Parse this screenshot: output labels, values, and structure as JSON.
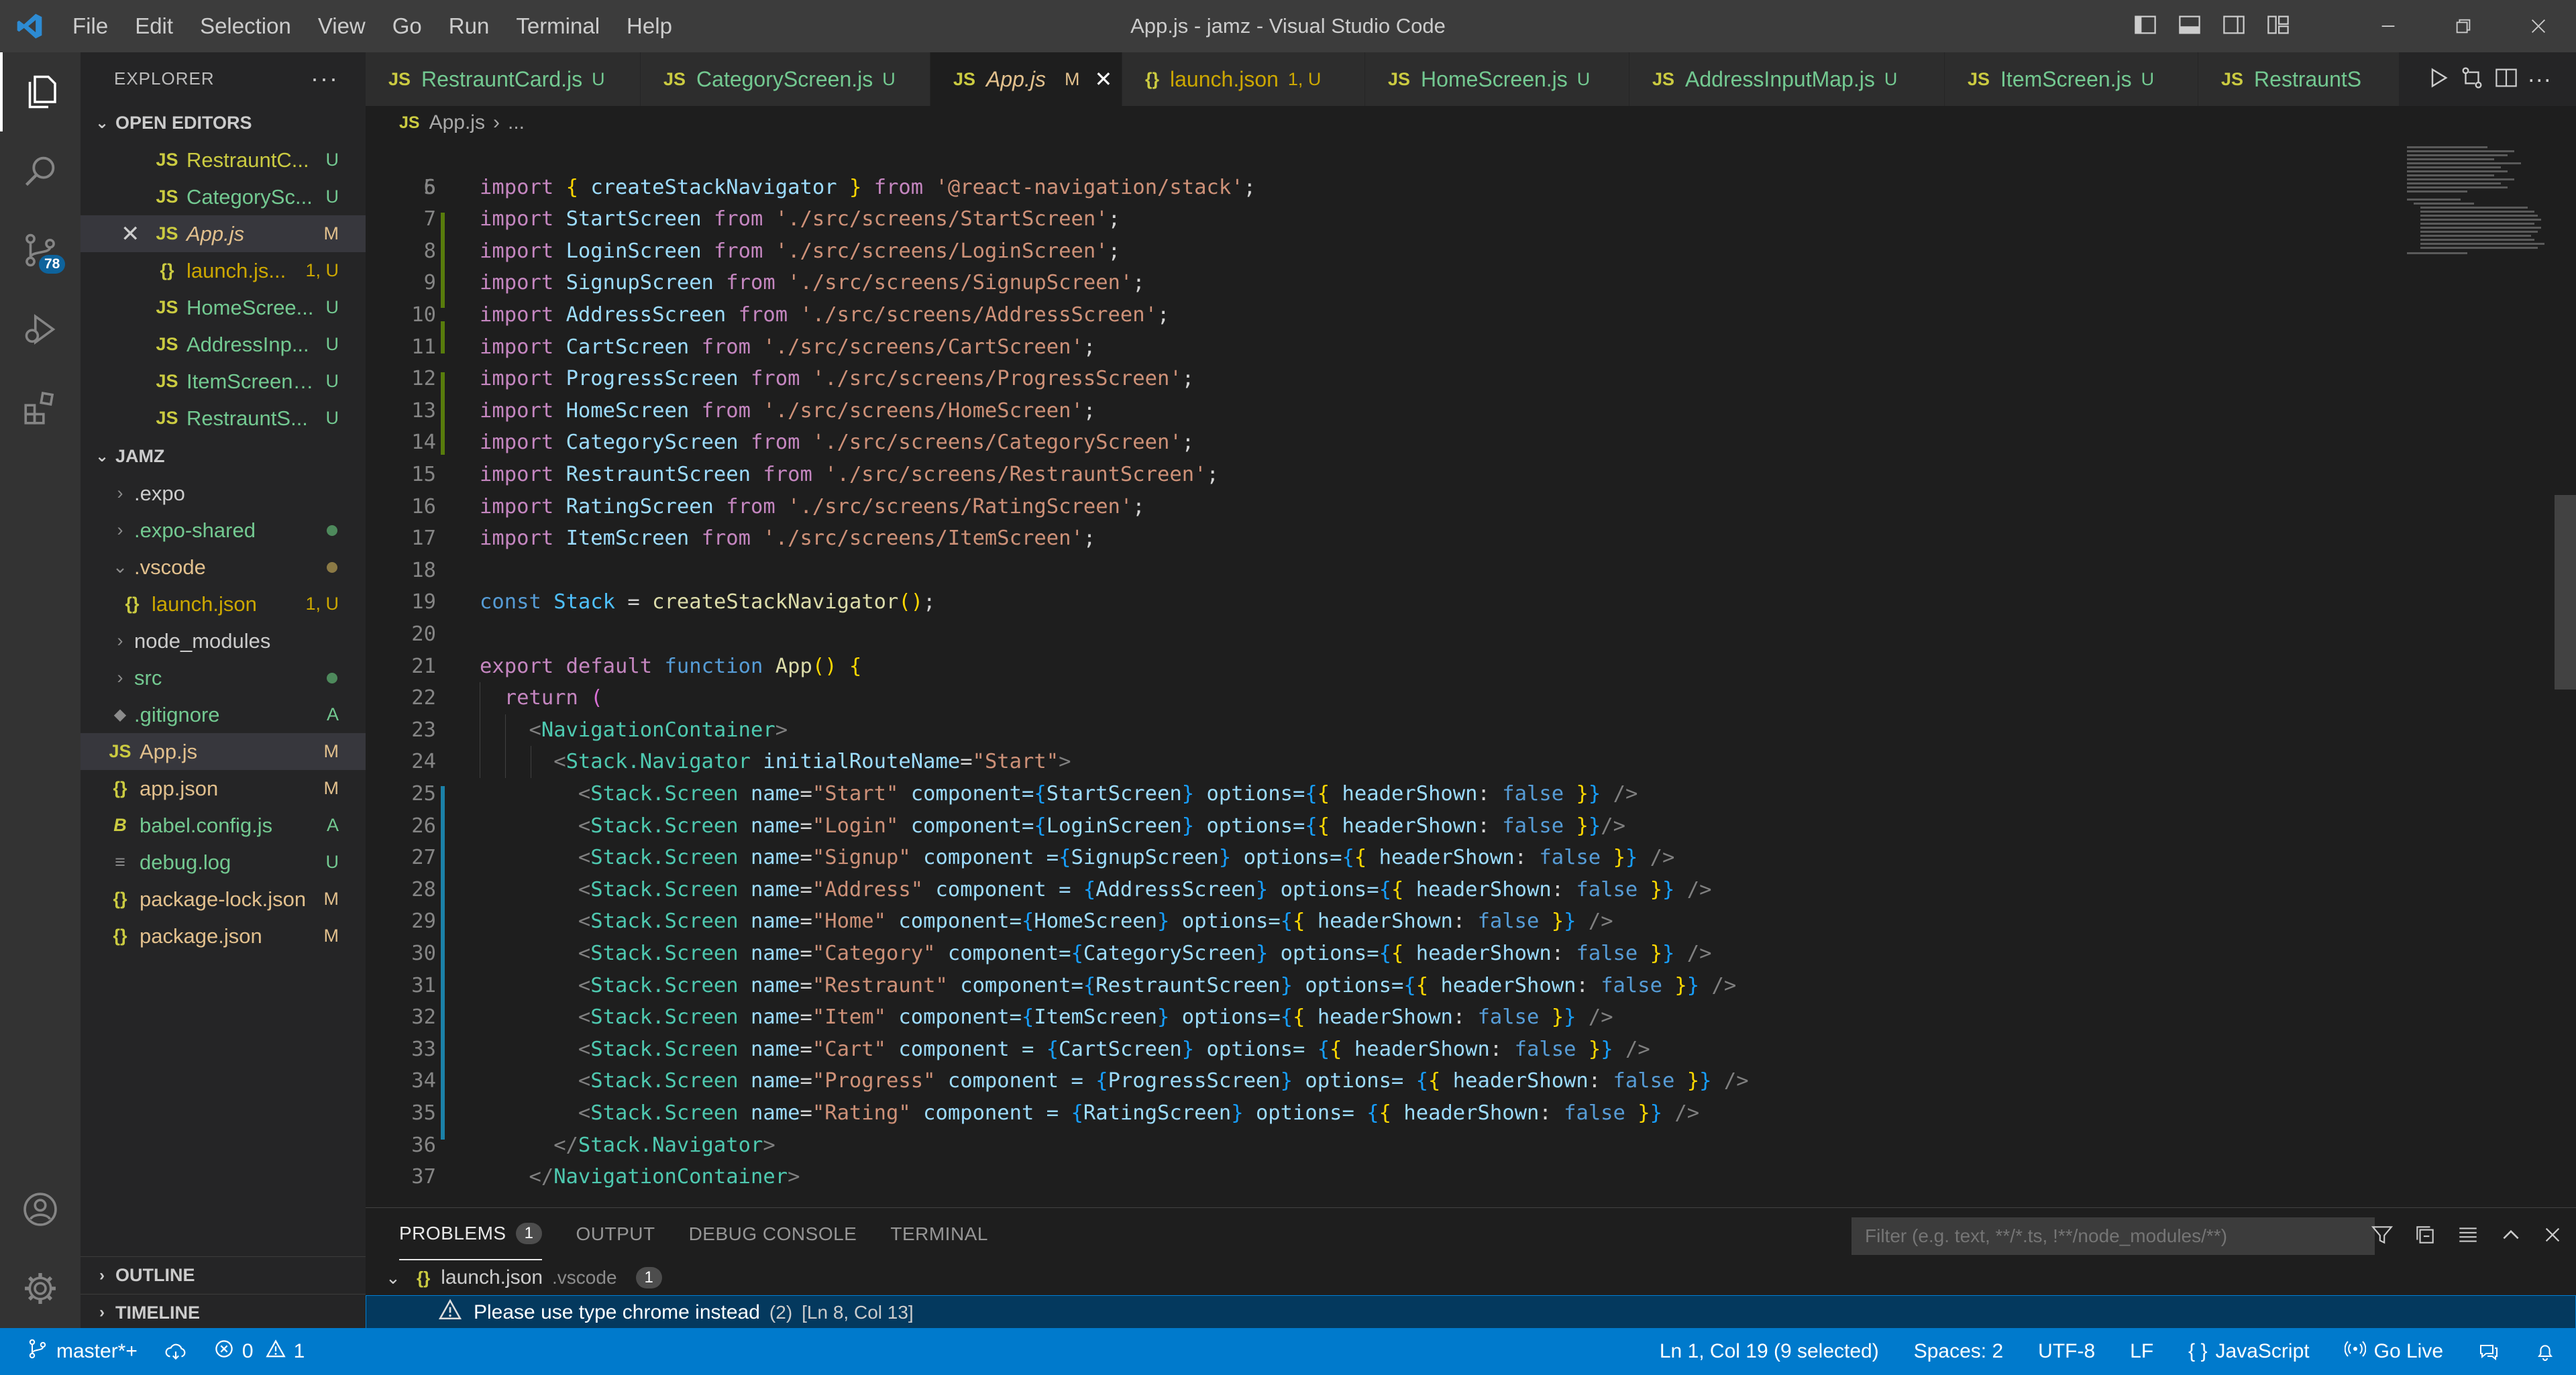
{
  "window": {
    "title": "App.js - jamz - Visual Studio Code"
  },
  "menu": [
    "File",
    "Edit",
    "Selection",
    "View",
    "Go",
    "Run",
    "Terminal",
    "Help"
  ],
  "activity": {
    "scm_badge": "78"
  },
  "explorer": {
    "title": "EXPLORER",
    "open_editors_label": "OPEN EDITORS",
    "open_editors": [
      {
        "icon": "JS",
        "name": "RestrauntC...",
        "status": "U"
      },
      {
        "icon": "JS",
        "name": "CategorySc...",
        "status": "U"
      },
      {
        "icon": "JS",
        "name": "App.js",
        "status": "M"
      },
      {
        "icon": "{}",
        "name": "launch.js...",
        "status": "1, U"
      },
      {
        "icon": "JS",
        "name": "HomeScree...",
        "status": "U"
      },
      {
        "icon": "JS",
        "name": "AddressInp...",
        "status": "U"
      },
      {
        "icon": "JS",
        "name": "ItemScreen....",
        "status": "U"
      },
      {
        "icon": "JS",
        "name": "RestrauntS...",
        "status": "U"
      }
    ],
    "project_label": "JAMZ",
    "tree": [
      {
        "name": ".expo",
        "status": ""
      },
      {
        "name": ".expo-shared",
        "status": ""
      },
      {
        "name": ".vscode",
        "status": ""
      },
      {
        "name": "launch.json",
        "status": "1, U",
        "icon": "{}"
      },
      {
        "name": "node_modules",
        "status": ""
      },
      {
        "name": "src",
        "status": ""
      },
      {
        "name": ".gitignore",
        "status": "A"
      },
      {
        "name": "App.js",
        "status": "M",
        "icon": "JS"
      },
      {
        "name": "app.json",
        "status": "M",
        "icon": "{}"
      },
      {
        "name": "babel.config.js",
        "status": "A",
        "icon": "B"
      },
      {
        "name": "debug.log",
        "status": "U",
        "icon": "≡"
      },
      {
        "name": "package-lock.json",
        "status": "M",
        "icon": "{}"
      },
      {
        "name": "package.json",
        "status": "M",
        "icon": "{}"
      }
    ],
    "outline_label": "OUTLINE",
    "timeline_label": "TIMELINE"
  },
  "tabs": [
    {
      "icon": "JS",
      "name": "RestrauntCard.js",
      "status": "U"
    },
    {
      "icon": "JS",
      "name": "CategoryScreen.js",
      "status": "U"
    },
    {
      "icon": "JS",
      "name": "App.js",
      "status": "M"
    },
    {
      "icon": "{}",
      "name": "launch.json",
      "status": "1, U"
    },
    {
      "icon": "JS",
      "name": "HomeScreen.js",
      "status": "U"
    },
    {
      "icon": "JS",
      "name": "AddressInputMap.js",
      "status": "U"
    },
    {
      "icon": "JS",
      "name": "ItemScreen.js",
      "status": "U"
    },
    {
      "icon": "JS",
      "name": "RestrauntS",
      "status": ""
    }
  ],
  "breadcrumb": {
    "file": "App.js",
    "rest": "..."
  },
  "code": {
    "imports": [
      {
        "n": "7",
        "name": "StartScreen",
        "path": "'./src/screens/StartScreen'"
      },
      {
        "n": "8",
        "name": "LoginScreen",
        "path": "'./src/screens/LoginScreen'"
      },
      {
        "n": "9",
        "name": "SignupScreen",
        "path": "'./src/screens/SignupScreen'"
      },
      {
        "n": "10",
        "name": "AddressScreen",
        "path": "'./src/screens/AddressScreen'"
      },
      {
        "n": "11",
        "name": "CartScreen",
        "path": "'./src/screens/CartScreen'"
      },
      {
        "n": "12",
        "name": "ProgressScreen",
        "path": "'./src/screens/ProgressScreen'"
      },
      {
        "n": "13",
        "name": "HomeScreen",
        "path": "'./src/screens/HomeScreen'"
      },
      {
        "n": "14",
        "name": "CategoryScreen",
        "path": "'./src/screens/CategoryScreen'"
      },
      {
        "n": "15",
        "name": "RestrauntScreen",
        "path": "'./src/screens/RestrauntScreen'"
      },
      {
        "n": "16",
        "name": "RatingScreen",
        "path": "'./src/screens/RatingScreen'"
      },
      {
        "n": "17",
        "name": "ItemScreen",
        "path": "'./src/screens/ItemScreen'"
      }
    ],
    "screens": [
      {
        "n": "25",
        "name": "\"Start\"",
        "comp_sep": " component=",
        "comp": "StartScreen",
        "opt_sep": " options=",
        "close": " />"
      },
      {
        "n": "26",
        "name": "\"Login\"",
        "comp_sep": " component=",
        "comp": "LoginScreen",
        "opt_sep": " options=",
        "close": "/>"
      },
      {
        "n": "27",
        "name": "\"Signup\"",
        "comp_sep": " component =",
        "comp": "SignupScreen",
        "opt_sep": " options=",
        "close": " />"
      },
      {
        "n": "28",
        "name": "\"Address\"",
        "comp_sep": " component = ",
        "comp": "AddressScreen",
        "opt_sep": " options=",
        "close": " />"
      },
      {
        "n": "29",
        "name": "\"Home\"",
        "comp_sep": " component=",
        "comp": "HomeScreen",
        "opt_sep": " options=",
        "close": " />"
      },
      {
        "n": "30",
        "name": "\"Category\"",
        "comp_sep": " component=",
        "comp": "CategoryScreen",
        "opt_sep": " options=",
        "close": " />"
      },
      {
        "n": "31",
        "name": "\"Restraunt\"",
        "comp_sep": " component=",
        "comp": "RestrauntScreen",
        "opt_sep": " options=",
        "close": " />"
      },
      {
        "n": "32",
        "name": "\"Item\"",
        "comp_sep": " component=",
        "comp": "ItemScreen",
        "opt_sep": " options=",
        "close": " />"
      },
      {
        "n": "33",
        "name": "\"Cart\"",
        "comp_sep": " component = ",
        "comp": "CartScreen",
        "opt_sep": " options= ",
        "close": " />"
      },
      {
        "n": "34",
        "name": "\"Progress\"",
        "comp_sep": " component = ",
        "comp": "ProgressScreen",
        "opt_sep": " options= ",
        "close": " />"
      },
      {
        "n": "35",
        "name": "\"Rating\"",
        "comp_sep": " component = ",
        "comp": "RatingScreen",
        "opt_sep": " options= ",
        "close": " />"
      }
    ]
  },
  "panel": {
    "tabs": [
      "PROBLEMS",
      "OUTPUT",
      "DEBUG CONSOLE",
      "TERMINAL"
    ],
    "problems_count": "1",
    "filter_placeholder": "Filter (e.g. text, **/*.ts, !**/node_modules/**)",
    "file": "launch.json",
    "folder": ".vscode",
    "file_count": "1",
    "message": "Please use type chrome instead",
    "message_count": "(2)",
    "location": "[Ln 8, Col 13]"
  },
  "status": {
    "branch": "master*+",
    "errors": "0",
    "warnings": "1",
    "position": "Ln 1, Col 19 (9 selected)",
    "spaces": "Spaces: 2",
    "encoding": "UTF-8",
    "eol": "LF",
    "language": "JavaScript",
    "golive": "Go Live"
  }
}
